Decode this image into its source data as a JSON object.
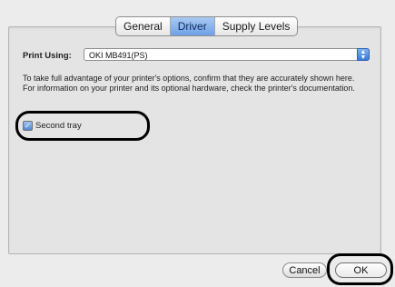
{
  "tabs": [
    {
      "label": "General",
      "selected": false
    },
    {
      "label": "Driver",
      "selected": true
    },
    {
      "label": "Supply Levels",
      "selected": false
    }
  ],
  "print_using": {
    "label": "Print Using:",
    "value": "OKI MB491(PS)"
  },
  "description": "To take full advantage of your printer's options, confirm that they are accurately shown here. For information on your printer and its optional hardware, check the printer's documentation.",
  "option": {
    "label": "Second tray",
    "checked": true
  },
  "buttons": {
    "cancel": "Cancel",
    "ok": "OK"
  },
  "colors": {
    "selected_tab": "#6fa1e6",
    "highlight_oval": "#000000"
  }
}
